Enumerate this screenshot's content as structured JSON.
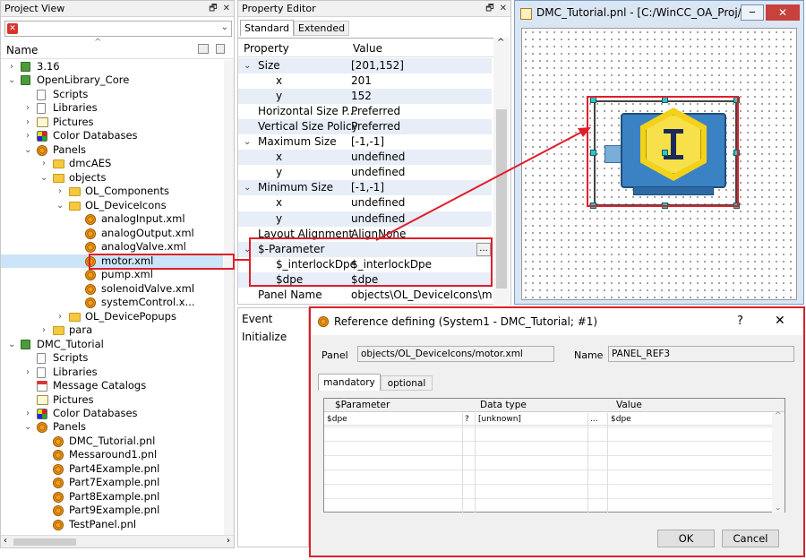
{
  "project_view": {
    "title": "Project View",
    "column_name": "Name",
    "tree": [
      {
        "label": "3.16",
        "icon": "package-icon",
        "depth": 0,
        "twisty": "›"
      },
      {
        "label": "OpenLibrary_Core",
        "icon": "package-icon",
        "depth": 0,
        "twisty": "⌄"
      },
      {
        "label": "Scripts",
        "icon": "script-icon",
        "depth": 1,
        "twisty": ""
      },
      {
        "label": "Libraries",
        "icon": "library-icon",
        "depth": 1,
        "twisty": "›"
      },
      {
        "label": "Pictures",
        "icon": "pictures-icon",
        "depth": 1,
        "twisty": "›"
      },
      {
        "label": "Color Databases",
        "icon": "color-db-icon",
        "depth": 1,
        "twisty": "›"
      },
      {
        "label": "Panels",
        "icon": "gear-icon",
        "depth": 1,
        "twisty": "⌄"
      },
      {
        "label": "dmcAES",
        "icon": "folder-icon",
        "depth": 2,
        "twisty": "›"
      },
      {
        "label": "objects",
        "icon": "folder-icon",
        "depth": 2,
        "twisty": "⌄"
      },
      {
        "label": "OL_Components",
        "icon": "folder-icon",
        "depth": 3,
        "twisty": "›"
      },
      {
        "label": "OL_DeviceIcons",
        "icon": "folder-icon",
        "depth": 3,
        "twisty": "⌄"
      },
      {
        "label": "analogInput.xml",
        "icon": "gear-icon",
        "depth": 4,
        "twisty": ""
      },
      {
        "label": "analogOutput.xml",
        "icon": "gear-icon",
        "depth": 4,
        "twisty": ""
      },
      {
        "label": "analogValve.xml",
        "icon": "gear-icon",
        "depth": 4,
        "twisty": ""
      },
      {
        "label": "motor.xml",
        "icon": "gear-icon",
        "depth": 4,
        "twisty": "",
        "selected": true
      },
      {
        "label": "pump.xml",
        "icon": "gear-icon",
        "depth": 4,
        "twisty": ""
      },
      {
        "label": "solenoidValve.xml",
        "icon": "gear-icon",
        "depth": 4,
        "twisty": ""
      },
      {
        "label": "systemControl.x...",
        "icon": "gear-icon",
        "depth": 4,
        "twisty": ""
      },
      {
        "label": "OL_DevicePopups",
        "icon": "folder-icon",
        "depth": 3,
        "twisty": "›"
      },
      {
        "label": "para",
        "icon": "folder-icon",
        "depth": 2,
        "twisty": "›"
      },
      {
        "label": "DMC_Tutorial",
        "icon": "package-icon",
        "depth": 0,
        "twisty": "⌄"
      },
      {
        "label": "Scripts",
        "icon": "script-icon",
        "depth": 1,
        "twisty": ""
      },
      {
        "label": "Libraries",
        "icon": "library-icon",
        "depth": 1,
        "twisty": "›"
      },
      {
        "label": "Message Catalogs",
        "icon": "message-catalog-icon",
        "depth": 1,
        "twisty": ""
      },
      {
        "label": "Pictures",
        "icon": "pictures-icon",
        "depth": 1,
        "twisty": ""
      },
      {
        "label": "Color Databases",
        "icon": "color-db-icon",
        "depth": 1,
        "twisty": "›"
      },
      {
        "label": "Panels",
        "icon": "gear-icon",
        "depth": 1,
        "twisty": "⌄"
      },
      {
        "label": "DMC_Tutorial.pnl",
        "icon": "gear-icon",
        "depth": 2,
        "twisty": ""
      },
      {
        "label": "Messaround1.pnl",
        "icon": "gear-icon",
        "depth": 2,
        "twisty": ""
      },
      {
        "label": "Part4Example.pnl",
        "icon": "gear-icon",
        "depth": 2,
        "twisty": ""
      },
      {
        "label": "Part7Example.pnl",
        "icon": "gear-icon",
        "depth": 2,
        "twisty": ""
      },
      {
        "label": "Part8Example.pnl",
        "icon": "gear-icon",
        "depth": 2,
        "twisty": ""
      },
      {
        "label": "Part9Example.pnl",
        "icon": "gear-icon",
        "depth": 2,
        "twisty": ""
      },
      {
        "label": "TestPanel.pnl",
        "icon": "gear-icon",
        "depth": 2,
        "twisty": ""
      }
    ]
  },
  "property_editor": {
    "title": "Property Editor",
    "tabs": [
      "Standard",
      "Extended"
    ],
    "col_property": "Property",
    "col_value": "Value",
    "rows": [
      {
        "name": "Size",
        "value": "[201,152]",
        "indent": 1,
        "twisty": "⌄",
        "alt": true
      },
      {
        "name": "x",
        "value": "201",
        "indent": 2,
        "twisty": "",
        "alt": false
      },
      {
        "name": "y",
        "value": "152",
        "indent": 2,
        "twisty": "",
        "alt": true
      },
      {
        "name": "Horizontal Size P...",
        "value": "Preferred",
        "indent": 1,
        "twisty": "",
        "alt": false
      },
      {
        "name": "Vertical Size Policy",
        "value": "Preferred",
        "indent": 1,
        "twisty": "",
        "alt": true
      },
      {
        "name": "Maximum Size",
        "value": "[-1,-1]",
        "indent": 1,
        "twisty": "⌄",
        "alt": false
      },
      {
        "name": "x",
        "value": "undefined",
        "indent": 2,
        "twisty": "",
        "alt": true
      },
      {
        "name": "y",
        "value": "undefined",
        "indent": 2,
        "twisty": "",
        "alt": false
      },
      {
        "name": "Minimum Size",
        "value": "[-1,-1]",
        "indent": 1,
        "twisty": "⌄",
        "alt": true
      },
      {
        "name": "x",
        "value": "undefined",
        "indent": 2,
        "twisty": "",
        "alt": false
      },
      {
        "name": "y",
        "value": "undefined",
        "indent": 2,
        "twisty": "",
        "alt": true
      },
      {
        "name": "Layout Alignment",
        "value": "AlignNone",
        "indent": 1,
        "twisty": "",
        "alt": false
      },
      {
        "name": "$-Parameter",
        "value": "",
        "indent": 1,
        "twisty": "⌄",
        "alt": true,
        "ellipsis": true
      },
      {
        "name": "$_interlockDpe",
        "value": "$_interlockDpe",
        "indent": 2,
        "twisty": "",
        "alt": false
      },
      {
        "name": "$dpe",
        "value": "$dpe",
        "indent": 2,
        "twisty": "",
        "alt": true
      },
      {
        "name": "Panel Name",
        "value": "objects\\OL_DeviceIcons\\mo...",
        "indent": 1,
        "twisty": "",
        "alt": false
      }
    ],
    "events": [
      "Event",
      "Initialize"
    ]
  },
  "panel_window": {
    "title": "DMC_Tutorial.pnl - [C:/WinCC_OA_Proj/D..."
  },
  "dialog": {
    "title": "Reference defining (System1 - DMC_Tutorial; #1)",
    "help": "?",
    "close": "✕",
    "panel_label": "Panel",
    "panel_value": "objects/OL_DeviceIcons/motor.xml",
    "name_label": "Name",
    "name_value": "PANEL_REF3",
    "tabs": [
      "mandatory",
      "optional"
    ],
    "col_parameter": "$Parameter",
    "col_datatype": "Data type",
    "col_value": "Value",
    "row": {
      "param": "$dpe",
      "q": "?",
      "datatype": "[unknown]",
      "dots": "...",
      "value": "$dpe"
    },
    "ok": "OK",
    "cancel": "Cancel"
  },
  "colors": {
    "highlight_red": "#e01e2a",
    "selection_handle": "#2dc7c7",
    "motor_blue": "#3b82c4",
    "motor_yellow": "#f2d21b"
  }
}
